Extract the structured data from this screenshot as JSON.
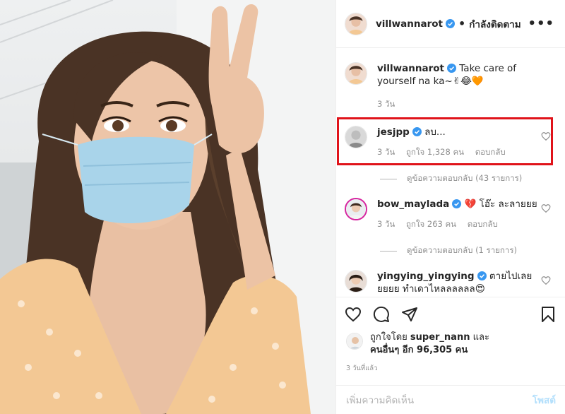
{
  "header": {
    "username": "villwannarot",
    "follow_status": "กำลังติดตาม",
    "separator": "•",
    "more": "•••"
  },
  "caption": {
    "username": "villwannarot",
    "text": "Take care of yourself na ka~✌😂🧡",
    "time": "3 วัน"
  },
  "comments": [
    {
      "username": "jesjpp",
      "text": "ลบ...",
      "time": "3 วัน",
      "likes": "ถูกใจ 1,328 คน",
      "reply": "ตอบกลับ",
      "view_replies": "ดูข้อความตอบกลับ (43 รายการ)"
    },
    {
      "username": "bow_maylada",
      "text": "💔 โอ๊ะ ละลายยย",
      "time": "3 วัน",
      "likes": "ถูกใจ 263 คน",
      "reply": "ตอบกลับ",
      "view_replies": "ดูข้อความตอบกลับ (1 รายการ)"
    },
    {
      "username": "yingying_yingying",
      "text": "ตายไปเลยยยยย ทำเดาไหลลลลลล😍"
    }
  ],
  "likes": {
    "prefix": "ถูกใจโดย",
    "user": "super_nann",
    "and": "และ",
    "others": "คนอื่นๆ อีก 96,305 คน"
  },
  "timestamp": "3 วันที่แล้ว",
  "add_comment": {
    "placeholder": "เพิ่มความคิดเห็น",
    "post": "โพสต์"
  },
  "colors": {
    "highlight": "#e0131a",
    "verified": "#3897f0",
    "post_disabled": "#b2dffc",
    "dress": "#f3c894",
    "mask": "#a9d4ea"
  }
}
